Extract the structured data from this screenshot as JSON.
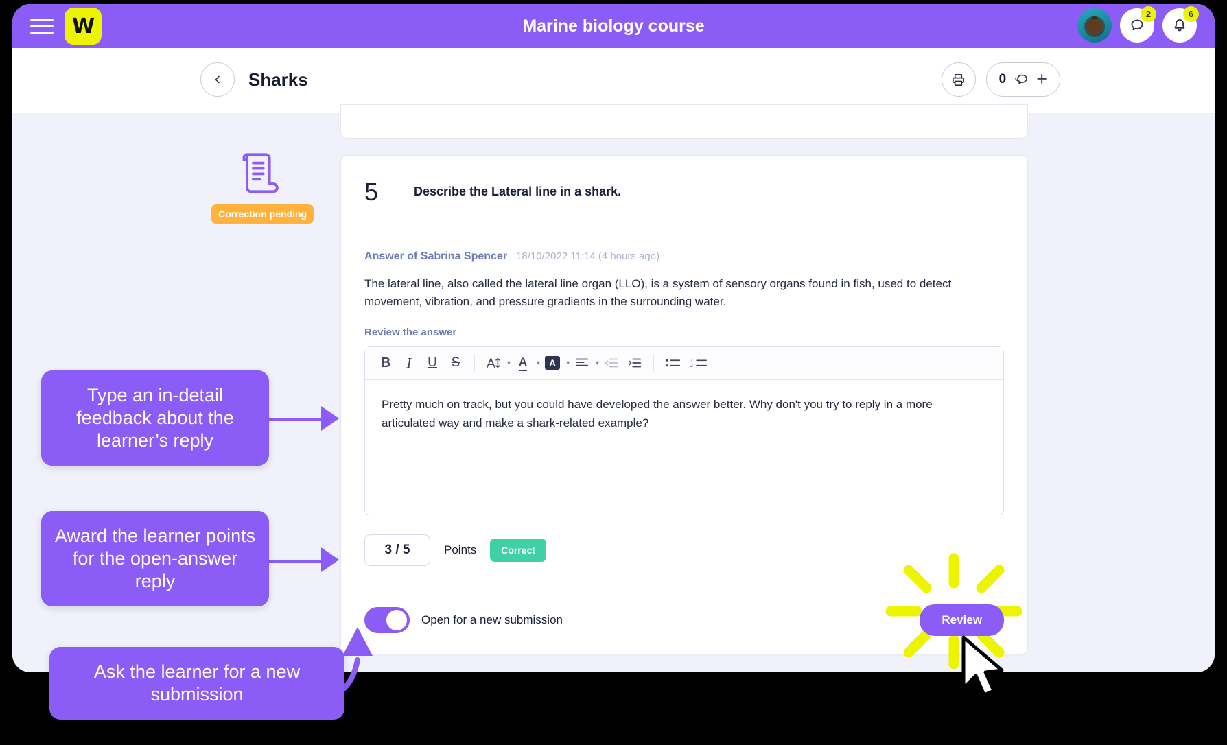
{
  "window": {
    "app_title": "Marine biology course"
  },
  "topbar": {
    "menu_icon": "hamburger-menu-icon",
    "logo_letter": "W",
    "avatar_alt": "user-avatar-turtle",
    "messages_icon": "chat-bubble-icon",
    "messages_badge": "2",
    "notifications_icon": "bell-icon",
    "notifications_badge": "6"
  },
  "subheader": {
    "back_icon": "chevron-left-icon",
    "page_title": "Sharks",
    "print_icon": "printer-icon",
    "comment_count": "0",
    "comment_icon": "comment-icon",
    "add_icon": "plus-icon"
  },
  "status": {
    "icon": "scroll-document-icon",
    "badge_label": "Correction pending",
    "badge_color": "#ffb33e"
  },
  "question": {
    "number": "5",
    "text": "Describe the Lateral line in a shark.",
    "answer_author": "Answer of Sabrina Spencer",
    "answer_timestamp": "18/10/2022 11:14 (4 hours ago)",
    "answer_body": "The lateral line, also called the lateral line organ (LLO), is a system of sensory organs found in fish, used to detect movement, vibration, and pressure gradients in the surrounding water.",
    "review_label": "Review the answer"
  },
  "editor": {
    "toolbar": [
      {
        "name": "bold-icon",
        "label": "B"
      },
      {
        "name": "italic-icon",
        "label": "I"
      },
      {
        "name": "underline-icon",
        "label": "U"
      },
      {
        "name": "strikethrough-icon",
        "label": "S"
      },
      {
        "name": "font-size-icon",
        "label": "AI"
      },
      {
        "name": "text-color-icon",
        "label": "A"
      },
      {
        "name": "highlight-color-icon",
        "label": "A"
      },
      {
        "name": "align-icon",
        "label": "align"
      },
      {
        "name": "outdent-icon",
        "label": "outdent"
      },
      {
        "name": "indent-icon",
        "label": "indent"
      },
      {
        "name": "bulleted-list-icon",
        "label": "bullets"
      },
      {
        "name": "numbered-list-icon",
        "label": "numbers"
      }
    ],
    "content": "Pretty much on track, but you could have developed the answer better. Why don't you try to reply in a more articulated way and make a shark-related example?",
    "placeholder": "Review the answer"
  },
  "grading": {
    "score_value": "3 / 5",
    "points_label": "Points",
    "result_badge": "Correct",
    "result_color": "#3fd0a3"
  },
  "footer": {
    "toggle_state": "on",
    "toggle_label": "Open for a new submission",
    "review_button": "Review"
  },
  "callouts": [
    {
      "id": "callout-1",
      "text": "Type an in-detail feedback about the learner’s reply"
    },
    {
      "id": "callout-2",
      "text": "Award the learner points for the open-answer reply"
    },
    {
      "id": "callout-3",
      "text": "Ask the learner for a new submission"
    }
  ],
  "colors": {
    "brand_purple": "#8b5cf6",
    "logo_yellow": "#ecf400",
    "page_bg": "#f0f1fa",
    "highlight_ray": "#ecf400"
  }
}
